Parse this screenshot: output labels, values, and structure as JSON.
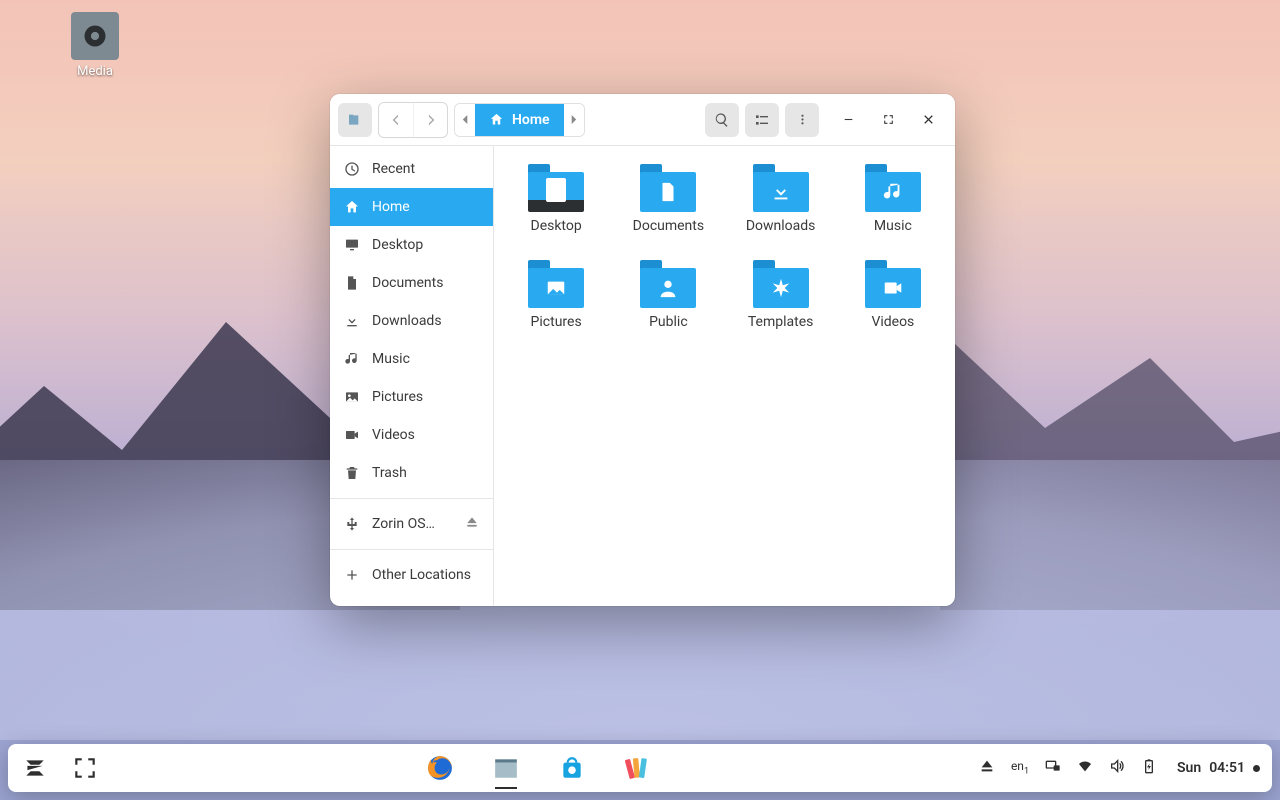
{
  "desktop": {
    "icon_label": "Media"
  },
  "window": {
    "breadcrumb": {
      "home": "Home"
    },
    "sidebar": {
      "recent": "Recent",
      "home": "Home",
      "desktop": "Desktop",
      "documents": "Documents",
      "downloads": "Downloads",
      "music": "Music",
      "pictures": "Pictures",
      "videos": "Videos",
      "trash": "Trash",
      "device_zorin": "Zorin OS…",
      "other_locations": "Other Locations"
    },
    "folders": {
      "desktop": "Desktop",
      "documents": "Documents",
      "downloads": "Downloads",
      "music": "Music",
      "pictures": "Pictures",
      "public": "Public",
      "templates": "Templates",
      "videos": "Videos"
    }
  },
  "taskbar": {
    "lang": "en",
    "lang_sub": "1",
    "clock_day": "Sun",
    "clock_time": "04:51"
  }
}
